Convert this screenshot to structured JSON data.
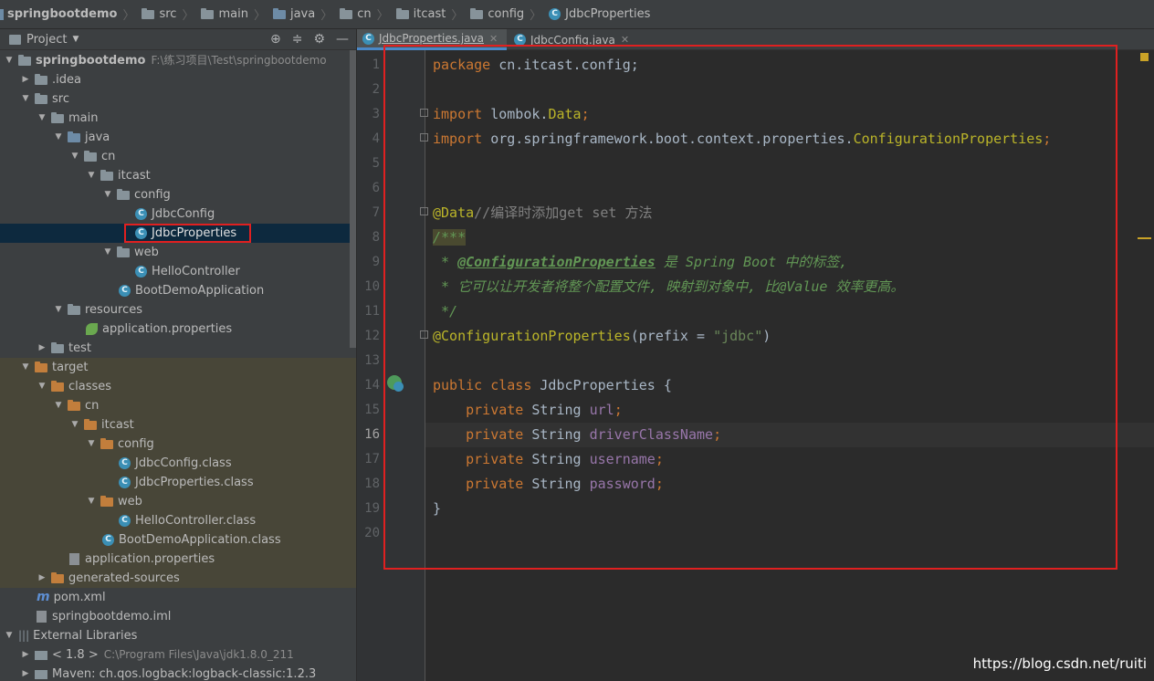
{
  "breadcrumb": [
    "springbootdemo",
    "src",
    "main",
    "java",
    "cn",
    "itcast",
    "config",
    "JdbcProperties"
  ],
  "sidebar": {
    "view_label": "Project",
    "tree": [
      {
        "label": "springbootdemo",
        "path": "F:\\练习项目\\Test\\springbootdemo"
      },
      {
        "label": ".idea"
      },
      {
        "label": "src"
      },
      {
        "label": "main"
      },
      {
        "label": "java"
      },
      {
        "label": "cn"
      },
      {
        "label": "itcast"
      },
      {
        "label": "config"
      },
      {
        "label": "JdbcConfig"
      },
      {
        "label": "JdbcProperties"
      },
      {
        "label": "web"
      },
      {
        "label": "HelloController"
      },
      {
        "label": "BootDemoApplication"
      },
      {
        "label": "resources"
      },
      {
        "label": "application.properties"
      },
      {
        "label": "test"
      },
      {
        "label": "target"
      },
      {
        "label": "classes"
      },
      {
        "label": "cn"
      },
      {
        "label": "itcast"
      },
      {
        "label": "config"
      },
      {
        "label": "JdbcConfig.class"
      },
      {
        "label": "JdbcProperties.class"
      },
      {
        "label": "web"
      },
      {
        "label": "HelloController.class"
      },
      {
        "label": "BootDemoApplication.class"
      },
      {
        "label": "application.properties"
      },
      {
        "label": "generated-sources"
      },
      {
        "label": "pom.xml"
      },
      {
        "label": "springbootdemo.iml"
      },
      {
        "label": "External Libraries"
      },
      {
        "label": "< 1.8 >",
        "path": "C:\\Program Files\\Java\\jdk1.8.0_211"
      },
      {
        "label": "Maven: ch.qos.logback:logback-classic:1.2.3"
      }
    ]
  },
  "tabs": [
    {
      "label": "JdbcProperties.java",
      "active": true
    },
    {
      "label": "JdbcConfig.java",
      "active": false
    }
  ],
  "editor": {
    "line_numbers": [
      "1",
      "2",
      "3",
      "4",
      "5",
      "6",
      "7",
      "8",
      "9",
      "10",
      "11",
      "12",
      "13",
      "14",
      "15",
      "16",
      "17",
      "18",
      "19",
      "20"
    ],
    "current_line": "16",
    "code": {
      "l1_kw": "package",
      "l1_rest": " cn.itcast.config;",
      "l3_kw": "import",
      "l3_a": " lombok.",
      "l3_b": "Data",
      "l3_c": ";",
      "l4_kw": "import",
      "l4_a": " org.springframework.boot.context.properties.",
      "l4_b": "ConfigurationProperties",
      "l4_c": ";",
      "l7_ann": "@Data",
      "l7_cmt": "//编译时添加get set 方法",
      "l8": "/***",
      "l9_a": " * ",
      "l9_b": "@ConfigurationProperties",
      "l9_c": " 是 Spring Boot 中的标签,",
      "l10": " * 它可以让开发者将整个配置文件, 映射到对象中, 比@Value 效率更高。",
      "l11": " */",
      "l12_ann": "@ConfigurationProperties",
      "l12_a": "(prefix = ",
      "l12_str": "\"jdbc\"",
      "l12_b": ")",
      "l14_kw": "public class",
      "l14_rest": " JdbcProperties {",
      "fields_kw": "private",
      "fields_type": " String ",
      "fields": [
        "url",
        "driverClassName",
        "username",
        "password"
      ],
      "semicolon": ";",
      "l19": "}"
    }
  },
  "watermark": "https://blog.csdn.net/ruiti",
  "colors": {
    "keyword": "#cc7832",
    "annotation": "#bbb529",
    "string": "#6a8759",
    "field": "#9876aa",
    "doc_comment": "#629755",
    "highlight_red": "#e02020"
  }
}
